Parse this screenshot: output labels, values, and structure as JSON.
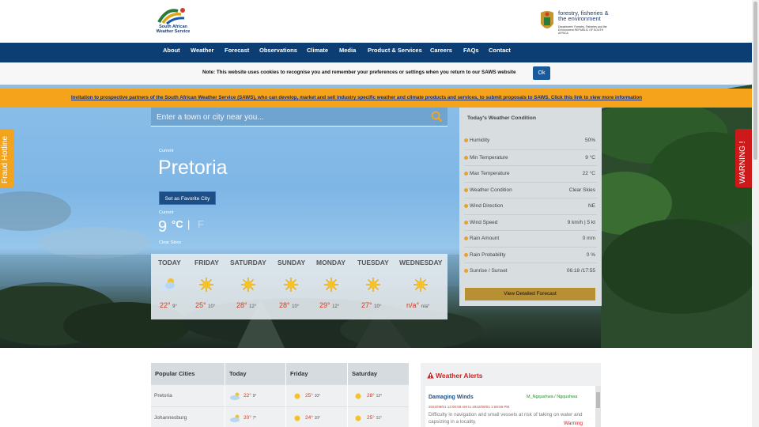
{
  "header": {
    "saws_logo_text": "South African Weather Service",
    "dffe_logo_title": "forestry, fisheries & the environment",
    "dffe_logo_sub": "Department: Forestry, Fisheries and the Environment REPUBLIC OF SOUTH AFRICA"
  },
  "nav": {
    "items": [
      "About",
      "Weather",
      "Forecast",
      "Observations",
      "Climate",
      "Media",
      "Product & Services",
      "Careers",
      "FAQs",
      "Contact"
    ]
  },
  "cookie": {
    "text": "Note: This website uses cookies to recognise you and remember your preferences or settings when you return to our SAWS website",
    "ok_label": "Ok"
  },
  "banner": {
    "text": "Invitation to prospective partners of the South African Weather Service (SAWS), who can develop, market and sell industry specific weather and climate products and services, to submit proposals to SAWS.  Click this link to view more information"
  },
  "search": {
    "placeholder": "Enter a town or city near you..."
  },
  "side_tabs": {
    "fraud": "Fraud Hotline",
    "warning": "WARNING !"
  },
  "current": {
    "label": "Current",
    "city": "Pretoria",
    "favorite_label": "Set as Favorite City",
    "label2": "Current",
    "temp": "9",
    "unit_c": "°C",
    "separator": "|",
    "unit_f": "F",
    "description": "Clear Skies"
  },
  "forecast": {
    "days": [
      {
        "name": "TODAY",
        "icon": "partly-cloudy-icon",
        "hi": "22°",
        "lo": "9°"
      },
      {
        "name": "FRIDAY",
        "icon": "sun-icon",
        "hi": "25°",
        "lo": "10°"
      },
      {
        "name": "SATURDAY",
        "icon": "sun-icon",
        "hi": "28°",
        "lo": "12°"
      },
      {
        "name": "SUNDAY",
        "icon": "sun-icon",
        "hi": "28°",
        "lo": "10°"
      },
      {
        "name": "MONDAY",
        "icon": "sun-icon",
        "hi": "29°",
        "lo": "12°"
      },
      {
        "name": "TUESDAY",
        "icon": "sun-icon",
        "hi": "27°",
        "lo": "10°"
      },
      {
        "name": "WEDNESDAY",
        "icon": "sun-icon",
        "hi": "n/a°",
        "lo": "n/a°"
      }
    ]
  },
  "conditions": {
    "title": "Today's Weather Condition",
    "rows": [
      {
        "label": "Humidity",
        "value": "50%"
      },
      {
        "label": "Min Temperature",
        "value": "9 °C"
      },
      {
        "label": "Max Temperature",
        "value": "22 °C"
      },
      {
        "label": "Weather Condition",
        "value": "Clear Skies"
      },
      {
        "label": "Wind Direction",
        "value": "NE"
      },
      {
        "label": "Wind Speed",
        "value": "9 km/h   |  5 kt"
      },
      {
        "label": "Rain Amount",
        "value": "0 mm"
      },
      {
        "label": "Rain Probability",
        "value": "0 %"
      },
      {
        "label": "Sunrise / Sunset",
        "value": "06:18 /17:55"
      }
    ],
    "button_label": "View Detailed Forecast"
  },
  "popular": {
    "headers": [
      "Popular Cities",
      "Today",
      "Friday",
      "Saturday"
    ],
    "rows": [
      {
        "city": "Pretoria",
        "today": {
          "hi": "22°",
          "lo": "9°"
        },
        "friday": {
          "hi": "25°",
          "lo": "10°"
        },
        "saturday": {
          "hi": "28°",
          "lo": "12°"
        }
      },
      {
        "city": "Johannesburg",
        "today": {
          "hi": "20°",
          "lo": "7°"
        },
        "friday": {
          "hi": "24°",
          "lo": "10°"
        },
        "saturday": {
          "hi": "25°",
          "lo": "11°"
        }
      }
    ]
  },
  "alerts": {
    "title": "Weather Alerts",
    "items": [
      {
        "name": "Damaging Winds",
        "area": "M_Ngqushwa / Ngqushwa",
        "date": "2022/09/01 12:00:00 AM to 2022/09/01 1:59:59 PM",
        "desc": "Difficulty in navigation and small vessels at risk of taking on water and capsizing in a locality.",
        "level": "Warning"
      }
    ]
  },
  "colors": {
    "nav_bg": "#0d3e73",
    "banner_bg": "#f4a31b",
    "temp_red": "#d43b1c",
    "warning_red": "#cc1a1a"
  }
}
